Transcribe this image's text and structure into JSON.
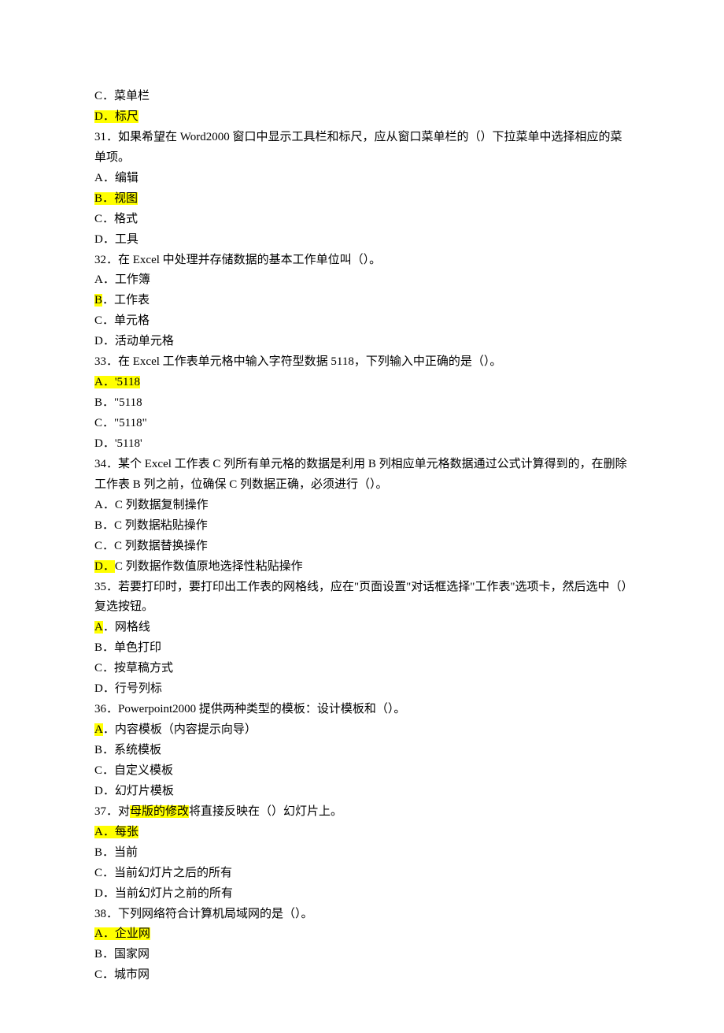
{
  "lines": [
    {
      "segments": [
        {
          "text": "C．菜单栏"
        }
      ]
    },
    {
      "segments": [
        {
          "text": "D．标尺",
          "hl": true
        }
      ]
    },
    {
      "segments": [
        {
          "text": "31．如果希望在 Word2000 窗口中显示工具栏和标尺，应从窗口菜单栏的（）下拉菜单中选择相应的菜单项。"
        }
      ]
    },
    {
      "segments": [
        {
          "text": "A．编辑"
        }
      ]
    },
    {
      "segments": [
        {
          "text": "B．视图",
          "hl": true
        }
      ]
    },
    {
      "segments": [
        {
          "text": "C．格式"
        }
      ]
    },
    {
      "segments": [
        {
          "text": "D．工具"
        }
      ]
    },
    {
      "segments": [
        {
          "text": "32．在 Excel 中处理并存储数据的基本工作单位叫（）。"
        }
      ]
    },
    {
      "segments": [
        {
          "text": "A．工作簿"
        }
      ]
    },
    {
      "segments": [
        {
          "text": "B",
          "hl": true
        },
        {
          "text": "．工作表"
        }
      ]
    },
    {
      "segments": [
        {
          "text": "C．单元格"
        }
      ]
    },
    {
      "segments": [
        {
          "text": "D．活动单元格"
        }
      ]
    },
    {
      "segments": [
        {
          "text": "33．在 Excel 工作表单元格中输入字符型数据 5118，下列输入中正确的是（）。"
        }
      ]
    },
    {
      "segments": [
        {
          "text": "A．'5118",
          "hl": true
        }
      ]
    },
    {
      "segments": [
        {
          "text": "B．\"5118"
        }
      ]
    },
    {
      "segments": [
        {
          "text": "C．\"5118\""
        }
      ]
    },
    {
      "segments": [
        {
          "text": "D．'5118'"
        }
      ]
    },
    {
      "segments": [
        {
          "text": "34．某个 Excel 工作表 C 列所有单元格的数据是利用 B 列相应单元格数据通过公式计算得到的，在删除工作表 B 列之前，位确保 C 列数据正确，必须进行（）。"
        }
      ]
    },
    {
      "segments": [
        {
          "text": "A．C 列数据复制操作"
        }
      ]
    },
    {
      "segments": [
        {
          "text": "B．C 列数据粘贴操作"
        }
      ]
    },
    {
      "segments": [
        {
          "text": "C．C 列数据替换操作"
        }
      ]
    },
    {
      "segments": [
        {
          "text": "D．",
          "hl": true
        },
        {
          "text": "C 列数据作数值原地选择性粘贴操作"
        }
      ]
    },
    {
      "segments": [
        {
          "text": "35．若要打印时，要打印出工作表的网格线，应在\"页面设置\"对话框选择\"工作表\"选项卡，然后选中（）复选按钮。"
        }
      ]
    },
    {
      "segments": [
        {
          "text": "A",
          "hl": true
        },
        {
          "text": "．网格线"
        }
      ]
    },
    {
      "segments": [
        {
          "text": "B．单色打印"
        }
      ]
    },
    {
      "segments": [
        {
          "text": "C．按草稿方式"
        }
      ]
    },
    {
      "segments": [
        {
          "text": "D．行号列标"
        }
      ]
    },
    {
      "segments": [
        {
          "text": "36．Powerpoint2000 提供两种类型的模板：设计模板和（）。"
        }
      ]
    },
    {
      "segments": [
        {
          "text": "A",
          "hl": true
        },
        {
          "text": "．内容模板（内容提示向导）"
        }
      ]
    },
    {
      "segments": [
        {
          "text": "B．系统模板"
        }
      ]
    },
    {
      "segments": [
        {
          "text": "C．自定义模板"
        }
      ]
    },
    {
      "segments": [
        {
          "text": "D．幻灯片模板"
        }
      ]
    },
    {
      "segments": [
        {
          "text": "37．对"
        },
        {
          "text": "母版的修改",
          "hl": true
        },
        {
          "text": "将直接反映在（）幻灯片上。"
        }
      ]
    },
    {
      "segments": [
        {
          "text": "A．每张",
          "hl": true
        }
      ]
    },
    {
      "segments": [
        {
          "text": "B．当前"
        }
      ]
    },
    {
      "segments": [
        {
          "text": "C．当前幻灯片之后的所有"
        }
      ]
    },
    {
      "segments": [
        {
          "text": "D．当前幻灯片之前的所有"
        }
      ]
    },
    {
      "segments": [
        {
          "text": "38．下列网络符合计算机局域网的是（）。"
        }
      ]
    },
    {
      "segments": [
        {
          "text": "A．企业网",
          "hl": true
        }
      ]
    },
    {
      "segments": [
        {
          "text": "B．国家网"
        }
      ]
    },
    {
      "segments": [
        {
          "text": "C．城市网"
        }
      ]
    }
  ]
}
